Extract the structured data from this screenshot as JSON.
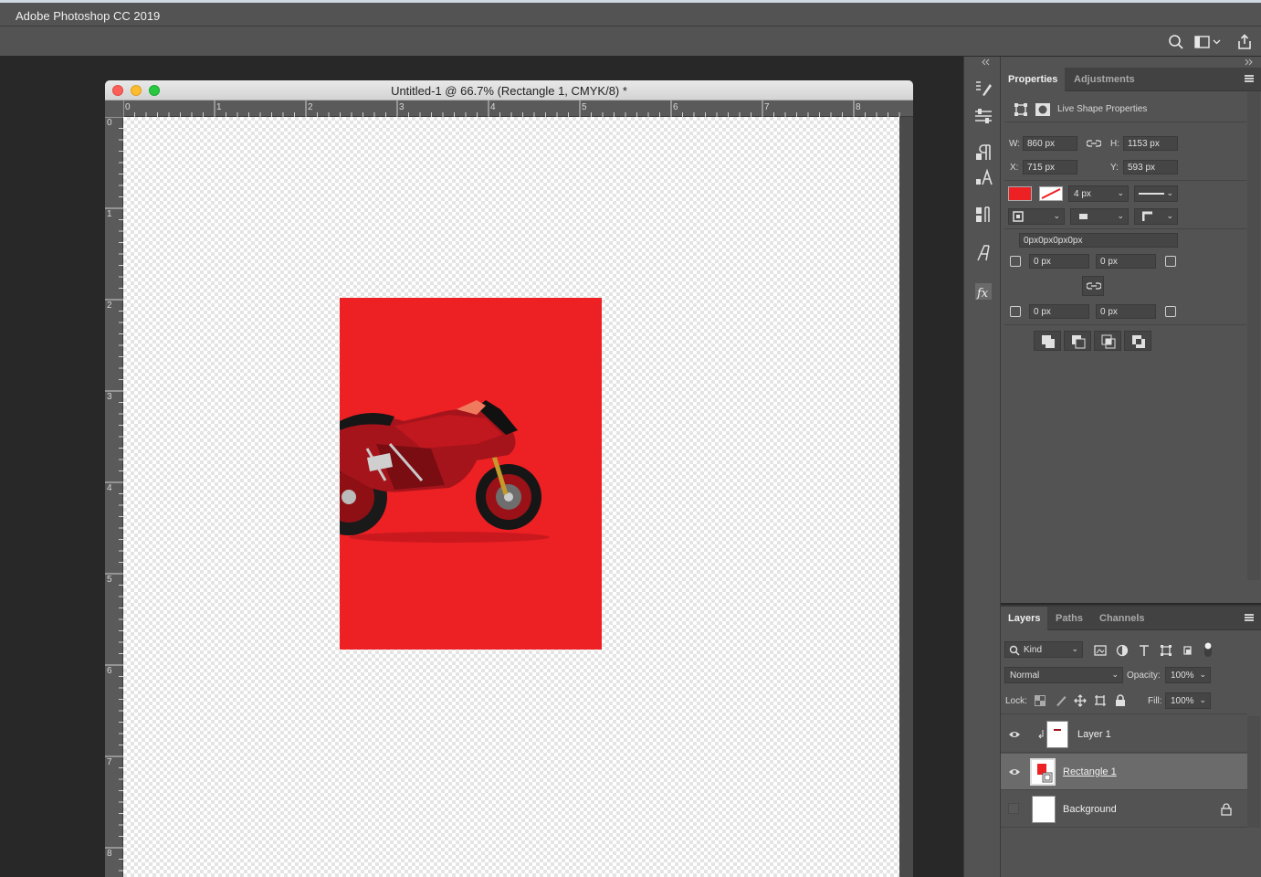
{
  "app": {
    "title": "Adobe Photoshop CC 2019"
  },
  "document": {
    "title": "Untitled-1 @ 66.7% (Rectangle 1, CMYK/8) *",
    "ruler_top": [
      "0",
      "1",
      "2",
      "3",
      "4",
      "5",
      "6",
      "7",
      "8"
    ],
    "ruler_left": [
      "0",
      "1",
      "2",
      "3",
      "4",
      "5",
      "6",
      "7",
      "8"
    ]
  },
  "properties": {
    "tabs": [
      "Properties",
      "Adjustments"
    ],
    "section_title": "Live Shape Properties",
    "w_label": "W:",
    "w_value": "860 px",
    "h_label": "H:",
    "h_value": "1153 px",
    "x_label": "X:",
    "x_value": "715 px",
    "y_label": "Y:",
    "y_value": "593 px",
    "stroke_width": "4 px",
    "radius_all": "0px0px0px0px",
    "radius_tl": "0 px",
    "radius_tr": "0 px",
    "radius_bl": "0 px",
    "radius_br": "0 px",
    "fill_color": "#ed2024"
  },
  "layers_panel": {
    "tabs": [
      "Layers",
      "Paths",
      "Channels"
    ],
    "filter": "Kind",
    "blend_mode": "Normal",
    "opacity_label": "Opacity:",
    "opacity": "100%",
    "lock_label": "Lock:",
    "fill_label": "Fill:",
    "fill": "100%",
    "layers": [
      {
        "name": "Layer 1",
        "visible": true,
        "selected": false
      },
      {
        "name": "Rectangle 1",
        "visible": true,
        "selected": true
      },
      {
        "name": "Background",
        "visible": false,
        "selected": false,
        "locked": true
      }
    ]
  }
}
